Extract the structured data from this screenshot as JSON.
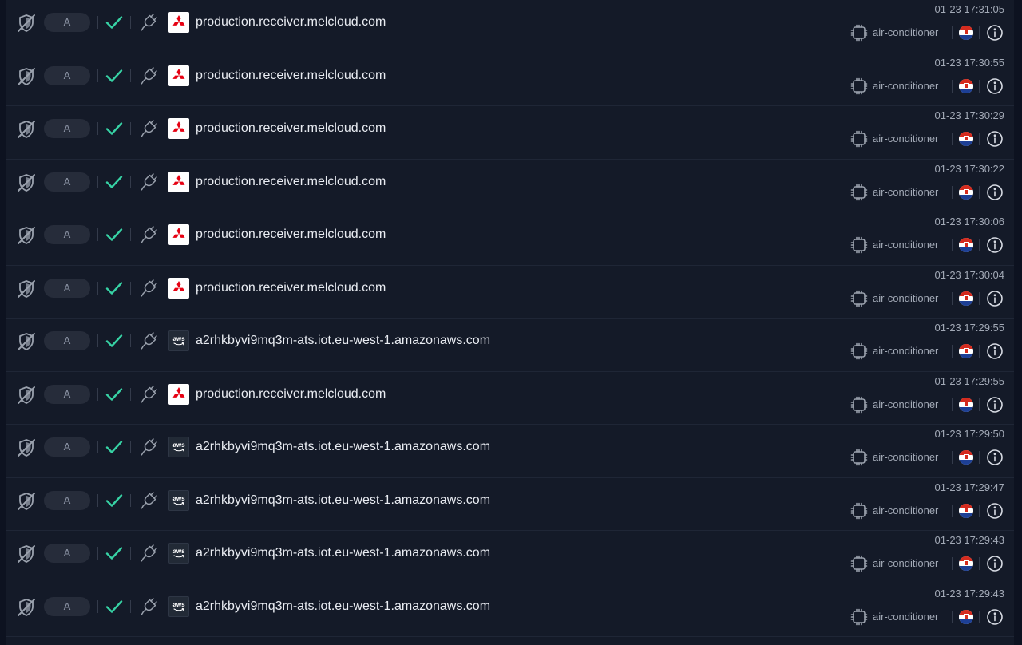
{
  "colors": {
    "background": "#0d1220",
    "panel": "#141a28",
    "check": "#37d3a5",
    "icon": "#9aa1ad",
    "text": "#e9ecf2",
    "muted": "#a2a9b6",
    "mitsubishi_red": "#e60012",
    "flag_red": "#d52b1e",
    "flag_blue": "#1d3f95"
  },
  "icons": {
    "status": "shield-off-icon",
    "allowed": "check-icon",
    "connection": "plug-icon",
    "device": "chip-icon",
    "info": "info-icon"
  },
  "rows": [
    {
      "record_type": "A",
      "domain": "production.receiver.melcloud.com",
      "logo": "mitsubishi",
      "timestamp": "01-23 17:31:05",
      "device_type": "air-conditioner",
      "flag": "croatia"
    },
    {
      "record_type": "A",
      "domain": "production.receiver.melcloud.com",
      "logo": "mitsubishi",
      "timestamp": "01-23 17:30:55",
      "device_type": "air-conditioner",
      "flag": "croatia"
    },
    {
      "record_type": "A",
      "domain": "production.receiver.melcloud.com",
      "logo": "mitsubishi",
      "timestamp": "01-23 17:30:29",
      "device_type": "air-conditioner",
      "flag": "croatia"
    },
    {
      "record_type": "A",
      "domain": "production.receiver.melcloud.com",
      "logo": "mitsubishi",
      "timestamp": "01-23 17:30:22",
      "device_type": "air-conditioner",
      "flag": "croatia"
    },
    {
      "record_type": "A",
      "domain": "production.receiver.melcloud.com",
      "logo": "mitsubishi",
      "timestamp": "01-23 17:30:06",
      "device_type": "air-conditioner",
      "flag": "croatia"
    },
    {
      "record_type": "A",
      "domain": "production.receiver.melcloud.com",
      "logo": "mitsubishi",
      "timestamp": "01-23 17:30:04",
      "device_type": "air-conditioner",
      "flag": "croatia"
    },
    {
      "record_type": "A",
      "domain": "a2rhkbyvi9mq3m-ats.iot.eu-west-1.amazonaws.com",
      "logo": "aws",
      "timestamp": "01-23 17:29:55",
      "device_type": "air-conditioner",
      "flag": "croatia"
    },
    {
      "record_type": "A",
      "domain": "production.receiver.melcloud.com",
      "logo": "mitsubishi",
      "timestamp": "01-23 17:29:55",
      "device_type": "air-conditioner",
      "flag": "croatia"
    },
    {
      "record_type": "A",
      "domain": "a2rhkbyvi9mq3m-ats.iot.eu-west-1.amazonaws.com",
      "logo": "aws",
      "timestamp": "01-23 17:29:50",
      "device_type": "air-conditioner",
      "flag": "croatia"
    },
    {
      "record_type": "A",
      "domain": "a2rhkbyvi9mq3m-ats.iot.eu-west-1.amazonaws.com",
      "logo": "aws",
      "timestamp": "01-23 17:29:47",
      "device_type": "air-conditioner",
      "flag": "croatia"
    },
    {
      "record_type": "A",
      "domain": "a2rhkbyvi9mq3m-ats.iot.eu-west-1.amazonaws.com",
      "logo": "aws",
      "timestamp": "01-23 17:29:43",
      "device_type": "air-conditioner",
      "flag": "croatia"
    },
    {
      "record_type": "A",
      "domain": "a2rhkbyvi9mq3m-ats.iot.eu-west-1.amazonaws.com",
      "logo": "aws",
      "timestamp": "01-23 17:29:43",
      "device_type": "air-conditioner",
      "flag": "croatia"
    }
  ]
}
